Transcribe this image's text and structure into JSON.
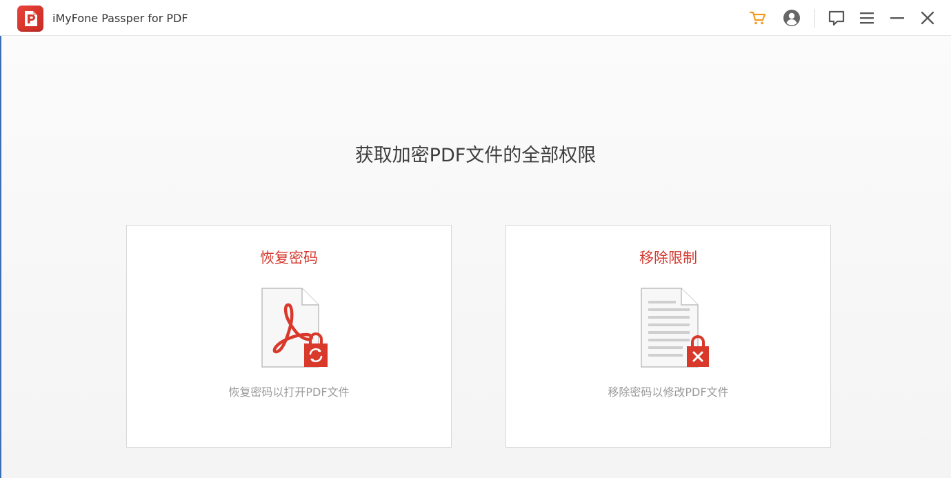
{
  "app": {
    "title": "iMyFone Passper for PDF"
  },
  "toolbar": {
    "icons": [
      "cart-icon",
      "account-icon",
      "feedback-icon",
      "menu-icon",
      "minimize-icon",
      "close-icon"
    ]
  },
  "colors": {
    "accent_red": "#d43a2f",
    "cart_orange": "#f39a1e",
    "icon_gray": "#555555"
  },
  "main": {
    "headline": "获取加密PDF文件的全部权限",
    "cards": [
      {
        "title": "恢复密码",
        "description": "恢复密码以打开PDF文件",
        "icon": "pdf-lock-refresh-icon"
      },
      {
        "title": "移除限制",
        "description": "移除密码以修改PDF文件",
        "icon": "document-lock-remove-icon"
      }
    ]
  }
}
